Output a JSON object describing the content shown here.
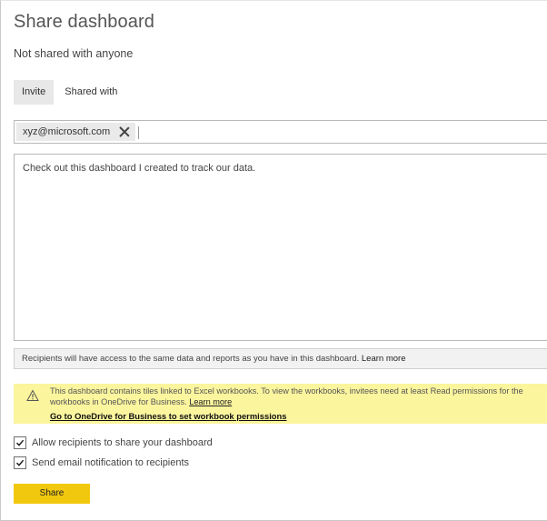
{
  "dialog": {
    "title": "Share dashboard",
    "status": "Not shared with anyone"
  },
  "tabs": [
    {
      "label": "Invite",
      "active": true
    },
    {
      "label": "Shared with",
      "active": false
    }
  ],
  "recipients": {
    "chips": [
      {
        "label": "xyz@microsoft.com",
        "icon": "close-icon"
      }
    ],
    "input_value": ""
  },
  "message": {
    "value": "Check out this dashboard I created to track our data."
  },
  "access_note": {
    "text": "Recipients will have access to the same data and reports as you have in this dashboard.",
    "link": "Learn more"
  },
  "warning": {
    "icon": "warning-icon",
    "text": "This dashboard contains tiles linked to Excel workbooks. To view the workbooks, invitees need at least Read permissions for the workbooks in OneDrive for Business.",
    "learn_more": "Learn more",
    "action_link": "Go to OneDrive for Business to set workbook permissions",
    "background_color": "#fbf59e"
  },
  "options": [
    {
      "label": "Allow recipients to share your dashboard",
      "checked": true
    },
    {
      "label": "Send email notification to recipients",
      "checked": true
    }
  ],
  "share_button": {
    "label": "Share",
    "color": "#f2c80f"
  }
}
